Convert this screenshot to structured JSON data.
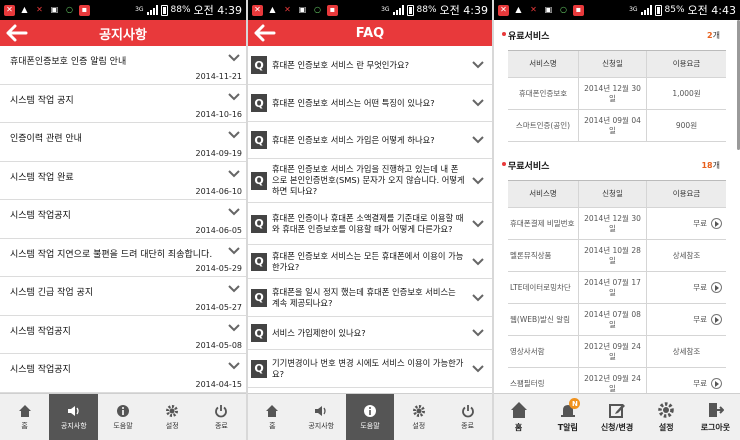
{
  "status_bars": [
    {
      "battery": "88%",
      "time": "오전 4:39",
      "net": "3G"
    },
    {
      "battery": "88%",
      "time": "오전 4:39",
      "net": "3G"
    },
    {
      "battery": "85%",
      "time": "오전 4:43",
      "net": "3G"
    }
  ],
  "notice": {
    "title": "공지사항",
    "items": [
      {
        "title": "휴대폰인증보호 인증 알림 안내",
        "date": "2014-11-21"
      },
      {
        "title": "시스템 작업 공지",
        "date": "2014-10-16"
      },
      {
        "title": "인증이력 관련 안내",
        "date": "2014-09-19"
      },
      {
        "title": "시스템 작업 완료",
        "date": "2014-06-10"
      },
      {
        "title": "시스템 작업공지",
        "date": "2014-06-05"
      },
      {
        "title": "시스템 작업 지연으로 불편을 드려 대단히 죄송합니다.",
        "date": "2014-05-29"
      },
      {
        "title": "시스템 긴급 작업 공지",
        "date": "2014-05-27"
      },
      {
        "title": "시스템 작업공지",
        "date": "2014-05-08"
      },
      {
        "title": "시스템 작업공지",
        "date": "2014-04-15"
      }
    ]
  },
  "faq": {
    "title": "FAQ",
    "badge": "Q",
    "items": [
      {
        "text": "휴대폰 인증보호 서비스 란 무엇인가요?"
      },
      {
        "text": "휴대폰 인증보호 서비스는 어떤 특징이 있나요?"
      },
      {
        "text": "휴대폰 인증보호 서비스 가입은 어떻게 하나요?"
      },
      {
        "text": "휴대폰 인증보호 서비스 가입을 진행하고 있는데 내 폰으로 본인인증번호(SMS) 문자가 오지 않습니다. 어떻게 하면 되나요?"
      },
      {
        "text": "휴대폰 인증이나 휴대폰 소액결제를 기준대로 이용할 때와 휴대폰 인증보호를 이용할 때가 어떻게 다른가요?"
      },
      {
        "text": "휴대폰 인증보호 서비스는 모든 휴대폰에서 이용이 가능한가요?"
      },
      {
        "text": "휴대폰을 일시 정지 했는데 휴대폰 인증보호 서비스는 계속 제공되나요?"
      },
      {
        "text": "서비스 가입제한이 있나요?"
      },
      {
        "text": "기기변경이나 번호 변경 시에도 서비스 이용이 가능한가요?"
      }
    ]
  },
  "nav_small": {
    "items": [
      {
        "label": "홈",
        "icon": "home-icon"
      },
      {
        "label": "공지사항",
        "icon": "speaker-icon"
      },
      {
        "label": "도움말",
        "icon": "info-icon"
      },
      {
        "label": "설정",
        "icon": "gear-icon"
      },
      {
        "label": "종료",
        "icon": "power-icon"
      }
    ]
  },
  "services": {
    "paid": {
      "title": "유료서비스",
      "count": "2",
      "count_unit": "개",
      "headers": [
        "서비스명",
        "신청일",
        "이용요금"
      ],
      "rows": [
        {
          "name": "휴대폰인증보호",
          "date": "2014년 12월 30일",
          "fee": "1,000원"
        },
        {
          "name": "스마트인증(공인)",
          "date": "2014년 09월 04일",
          "fee": "900원"
        }
      ]
    },
    "free": {
      "title": "무료서비스",
      "count": "18",
      "count_unit": "개",
      "headers": [
        "서비스명",
        "신청일",
        "이용요금"
      ],
      "rows": [
        {
          "name": "휴대폰결제 비밀번호",
          "date": "2014년 12월 30일",
          "fee": "무료",
          "arrow": true
        },
        {
          "name": "멜론뮤직상품",
          "date": "2014년 10월 28일",
          "fee": "상세참조",
          "arrow": false
        },
        {
          "name": "LTE데이터로밍차단",
          "date": "2014년 07월 17일",
          "fee": "무료",
          "arrow": true
        },
        {
          "name": "웹(WEB)발신 알림",
          "date": "2014년 07월 08일",
          "fee": "무료",
          "arrow": true
        },
        {
          "name": "영상사서함",
          "date": "2012년 09월 24일",
          "fee": "상세참조",
          "arrow": false
        },
        {
          "name": "스팸필터링",
          "date": "2012년 09월 24일",
          "fee": "무료",
          "arrow": true
        }
      ]
    }
  },
  "nav_big": {
    "items": [
      {
        "label": "홈",
        "icon": "home-icon"
      },
      {
        "label": "T알림",
        "icon": "bell-icon",
        "badge": "N"
      },
      {
        "label": "신청/변경",
        "icon": "edit-icon"
      },
      {
        "label": "설정",
        "icon": "gear-icon"
      },
      {
        "label": "로그아웃",
        "icon": "logout-icon"
      }
    ]
  },
  "colors": {
    "accent": "#e8393b",
    "count": "#e8601c",
    "nav_active": "#555555"
  }
}
